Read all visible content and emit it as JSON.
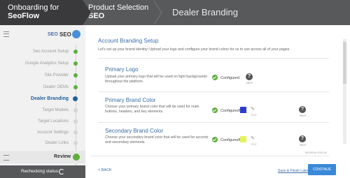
{
  "breadcrumbs": {
    "step1_line1": "Onboarding for",
    "step1_line2": "SeoFlow",
    "step2_line1": "Product Selection",
    "step2_line2": "SEO",
    "step3": "Dealer Branding"
  },
  "sidebar": {
    "logo_text": "SEO",
    "header_label": "SEO",
    "items": [
      {
        "label": "Seo Account Setup",
        "state": "complete"
      },
      {
        "label": "Google Analytics Setup",
        "state": "complete"
      },
      {
        "label": "Site Provider",
        "state": "complete"
      },
      {
        "label": "Dealer OEMs",
        "state": "complete"
      },
      {
        "label": "Dealer Branding",
        "state": "active"
      },
      {
        "label": "Target Models",
        "state": "pending"
      },
      {
        "label": "Target Locations",
        "state": "pending"
      },
      {
        "label": "Account Settings",
        "state": "pending"
      },
      {
        "label": "Dealer Links",
        "state": "pending"
      }
    ],
    "review_label": "Review",
    "status_text": "Rechecking status"
  },
  "main": {
    "title": "Account Branding Setup",
    "description": "Let's set up your brand identity! Upload your logo and configure your brand colors for us to use across all of your pages.",
    "sections": [
      {
        "title": "Primary Logo",
        "description": "Upload your primary logo that will be used on light backgrounds throughout the platform.",
        "status": "Configured",
        "help": "HELP"
      },
      {
        "title": "Primary Brand Color",
        "description": "Choose your primary brand color that will be used for main buttons, headers, and key elements.",
        "status": "Configured!",
        "swatch_color": "#2a3ccc",
        "edit": "EDIT",
        "help": "HELP"
      },
      {
        "title": "Secondary Brand Color",
        "description": "Choose your secondary brand color that will be used for accents and secondary elements.",
        "status": "Configured!",
        "swatch_color": "#e6f25a",
        "edit": "EDIT",
        "help": "HELP"
      }
    ],
    "tiny_link": "REFRESH STATUS",
    "back_label": "< BACK",
    "save_exit_label": "Save & Finish Later",
    "continue_label": "CONTINUE"
  },
  "colors": {
    "accent": "#3a89d8",
    "active_nav": "#1f5f9a",
    "complete": "#5fae3d",
    "topbar": "#58595b"
  }
}
